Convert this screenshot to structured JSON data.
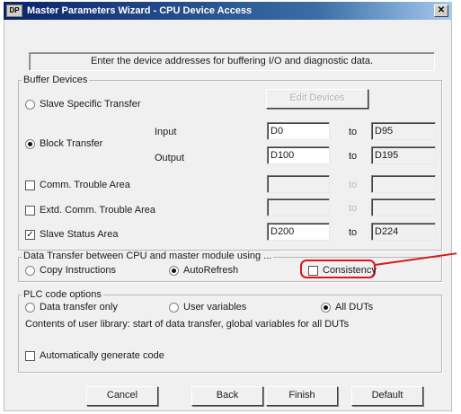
{
  "window": {
    "logo_text": "DP",
    "title": "Master Parameters Wizard - CPU Device Access",
    "close_glyph": "✕"
  },
  "instruction": "Enter the device addresses for buffering I/O and diagnostic data.",
  "buffer_devices": {
    "legend": "Buffer Devices",
    "slave_specific_transfer": {
      "label": "Slave Specific Transfer",
      "selected": false
    },
    "edit_devices_button": "Edit Devices",
    "block_transfer": {
      "label": "Block Transfer",
      "selected": true
    },
    "input_label": "Input",
    "output_label": "Output",
    "to_label": "to",
    "input_from": "D0",
    "input_to": "D95",
    "output_from": "D100",
    "output_to": "D195",
    "comm_trouble": {
      "label": "Comm. Trouble Area",
      "checked": false,
      "from": "",
      "to": ""
    },
    "extd_comm_trouble": {
      "label": "Extd. Comm. Trouble Area",
      "checked": false,
      "from": "",
      "to": ""
    },
    "slave_status": {
      "label": "Slave Status Area",
      "checked": true,
      "from": "D200",
      "to": "D224"
    }
  },
  "data_transfer": {
    "legend": "Data Transfer between CPU and master module using ...",
    "copy_instructions": {
      "label": "Copy Instructions",
      "selected": false
    },
    "autorefresh": {
      "label": "AutoRefresh",
      "selected": true
    },
    "consistency": {
      "label": "Consistency",
      "checked": false
    }
  },
  "plc_code": {
    "legend": "PLC code options",
    "data_transfer_only": {
      "label": "Data transfer only",
      "selected": false
    },
    "user_variables": {
      "label": "User variables",
      "selected": false
    },
    "all_duts": {
      "label": "All DUTs",
      "selected": true
    },
    "description": "Contents of user library: start of data transfer, global variables for all DUTs",
    "auto_generate": {
      "label": "Automatically generate code",
      "checked": false
    }
  },
  "buttons": {
    "cancel": "Cancel",
    "back": "Back",
    "finish": "Finish",
    "default": "Default"
  },
  "colors": {
    "title_bar": "#0a246a",
    "highlight": "#d81818",
    "dialog_background": "#f0f0f0"
  }
}
